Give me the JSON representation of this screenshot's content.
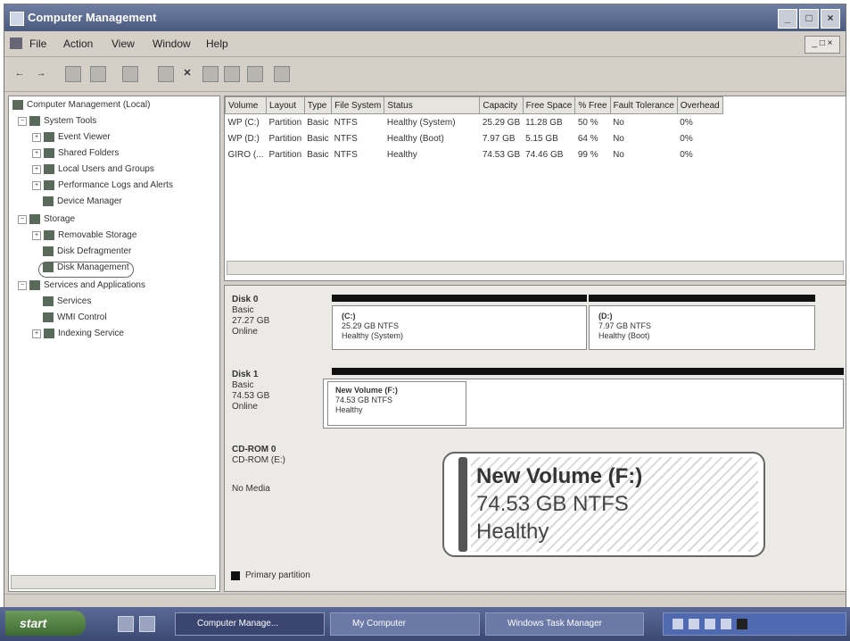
{
  "window": {
    "title": "Computer Management",
    "controls": [
      "_",
      "□",
      "×"
    ]
  },
  "menu": {
    "items": [
      "File",
      "Action",
      "View",
      "Window",
      "Help"
    ],
    "mdi_controls": "_ □ ×"
  },
  "toolbar": {
    "buttons": [
      "back-icon",
      "forward-icon",
      "up-icon",
      "show-hide-tree-icon",
      "properties-icon",
      "export-icon",
      "delete-icon",
      "settings-icon",
      "wizard-icon",
      "view-icon",
      "help-icon"
    ],
    "delete_glyph": "✕"
  },
  "tree": {
    "root": "Computer Management (Local)",
    "system_tools": "System Tools",
    "event_viewer": "Event Viewer",
    "shared_folders": "Shared Folders",
    "local_users": "Local Users and Groups",
    "perf_logs": "Performance Logs and Alerts",
    "device_manager": "Device Manager",
    "storage": "Storage",
    "removable_storage": "Removable Storage",
    "disk_defrag": "Disk Defragmenter",
    "disk_management": "Disk Management",
    "services_apps": "Services and Applications",
    "services": "Services",
    "wmi_control": "WMI Control",
    "indexing_service": "Indexing Service"
  },
  "volumes": {
    "columns": [
      "Volume",
      "Layout",
      "Type",
      "File System",
      "Status",
      "Capacity",
      "Free Space",
      "% Free",
      "Fault Tolerance",
      "Overhead"
    ],
    "rows": [
      [
        "WP (C:)",
        "Partition",
        "Basic",
        "NTFS",
        "Healthy (System)",
        "25.29 GB",
        "11.28 GB",
        "50 %",
        "No",
        "0%"
      ],
      [
        "WP (D:)",
        "Partition",
        "Basic",
        "NTFS",
        "Healthy (Boot)",
        "7.97 GB",
        "5.15 GB",
        "64 %",
        "No",
        "0%"
      ],
      [
        "GIRO (...",
        "Partition",
        "Basic",
        "NTFS",
        "Healthy",
        "74.53 GB",
        "74.46 GB",
        "99 %",
        "No",
        "0%"
      ]
    ]
  },
  "disks": {
    "disk0": {
      "name": "Disk 0",
      "type": "Basic",
      "size": "27.27 GB",
      "state": "Online",
      "p1": {
        "name": "(C:)",
        "fs": "25.29 GB NTFS",
        "status": "Healthy (System)"
      },
      "p2": {
        "name": "(D:)",
        "fs": "7.97 GB NTFS",
        "status": "Healthy (Boot)"
      }
    },
    "disk1": {
      "name": "Disk 1",
      "type": "Basic",
      "size": "74.53 GB",
      "state": "Online",
      "p1": {
        "name": "New Volume (F:)",
        "fs": "74.53 GB NTFS",
        "status": "Healthy"
      }
    },
    "cdrom": {
      "name": "CD-ROM 0",
      "drive": "CD-ROM (E:)",
      "media": "No Media"
    }
  },
  "callout": {
    "name": "New Volume  (F:)",
    "fs": "74.53 GB NTFS",
    "status": "Healthy"
  },
  "legend": {
    "primary": "Primary partition"
  },
  "taskbar": {
    "start": "start",
    "tasks": [
      "Computer Manage...",
      "My Computer",
      "Windows Task Manager"
    ]
  }
}
